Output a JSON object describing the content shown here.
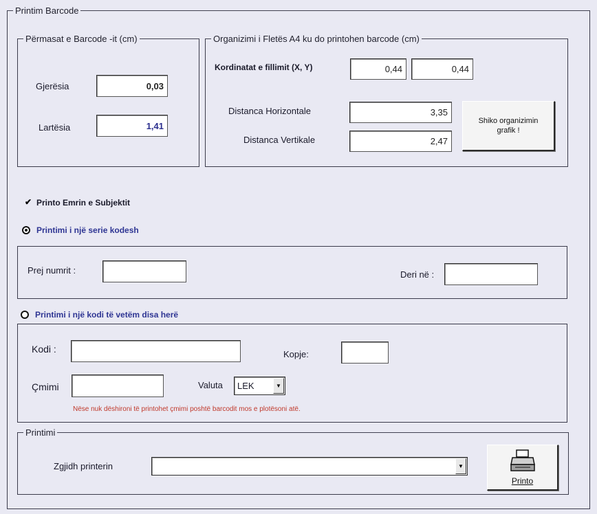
{
  "window": {
    "title": "Printim Barcode"
  },
  "dimensions": {
    "legend": "Përmasat e Barcode -it (cm)",
    "width_label": "Gjerësia",
    "width_value": "0,03",
    "height_label": "Lartësia",
    "height_value": "1,41"
  },
  "layout": {
    "legend": "Organizimi i Fletës A4 ku do printohen barcode (cm)",
    "coords_label": "Kordinatat e fillimit (X, Y)",
    "x_value": "0,44",
    "y_value": "0,44",
    "h_distance_label": "Distanca Horizontale",
    "h_distance_value": "3,35",
    "v_distance_label": "Distanca Vertikale",
    "v_distance_value": "2,47",
    "preview_button_line1": "Shiko organizimin",
    "preview_button_line2": "grafik !"
  },
  "options": {
    "print_name_label": "Printo Emrin e Subjektit",
    "print_name_checked": true,
    "series_label": "Printimi i një serie kodesh",
    "single_label": "Printimi i një kodi të vetëm disa herë",
    "selected": "series"
  },
  "series": {
    "from_label": "Prej numrit :",
    "from_value": "",
    "to_label": "Deri në :",
    "to_value": ""
  },
  "single": {
    "code_label": "Kodi :",
    "code_value": "",
    "copies_label": "Kopje:",
    "copies_value": "",
    "price_label": "Çmimi",
    "price_value": "",
    "currency_label": "Valuta",
    "currency_value": "LEK",
    "hint": "Nëse nuk dëshironi të printohet çmimi poshtë barcodit mos e plotësoni atë."
  },
  "printing": {
    "legend": "Printimi",
    "printer_label": "Zgjidh printerin",
    "printer_value": "",
    "print_button": "Printo"
  },
  "colors": {
    "background": "#e9e9f3",
    "accent_blue": "#2e3593",
    "hint_red": "#c0392b"
  }
}
